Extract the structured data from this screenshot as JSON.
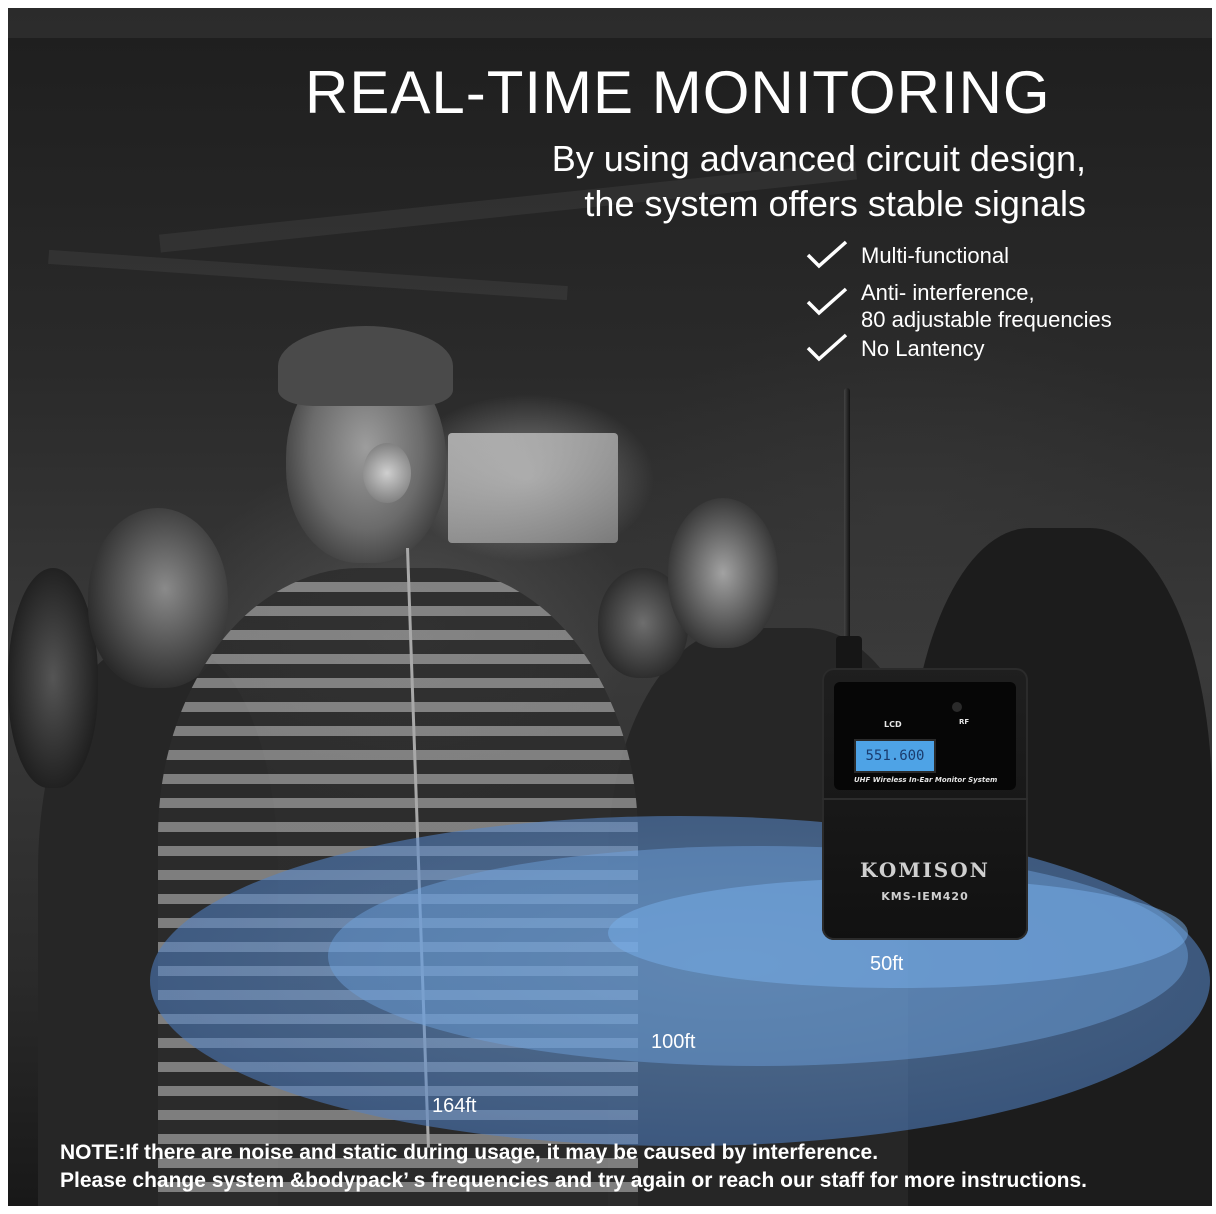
{
  "headline": "REAL-TIME MONITORING",
  "subtitle": {
    "line1": "By using advanced circuit design,",
    "line2": "the system offers stable signals"
  },
  "features": [
    {
      "text": "Multi-functional",
      "icon": "check-icon"
    },
    {
      "text": "Anti- interference,",
      "text2": "80 adjustable frequencies",
      "icon": "check-icon"
    },
    {
      "text": "No Lantency",
      "icon": "check-icon"
    }
  ],
  "device": {
    "lcd_label": "LCD",
    "rf_label": "RF",
    "display_value": "551.600",
    "description": "UHF Wireless In-Ear Monitor System",
    "brand": "KOMISON",
    "model": "KMS-IEM420"
  },
  "ranges": {
    "inner": "50ft",
    "middle": "100ft",
    "outer": "164ft"
  },
  "note": {
    "line1": "NOTE:If there are noise and static during usage, it may be caused by interference.",
    "line2": "Please change system &bodypack’ s frequencies and try again or reach our staff for more instructions."
  },
  "colors": {
    "range_blue": "#6ea5e1",
    "lcd_blue": "#4ea3e6",
    "text": "#ffffff"
  }
}
